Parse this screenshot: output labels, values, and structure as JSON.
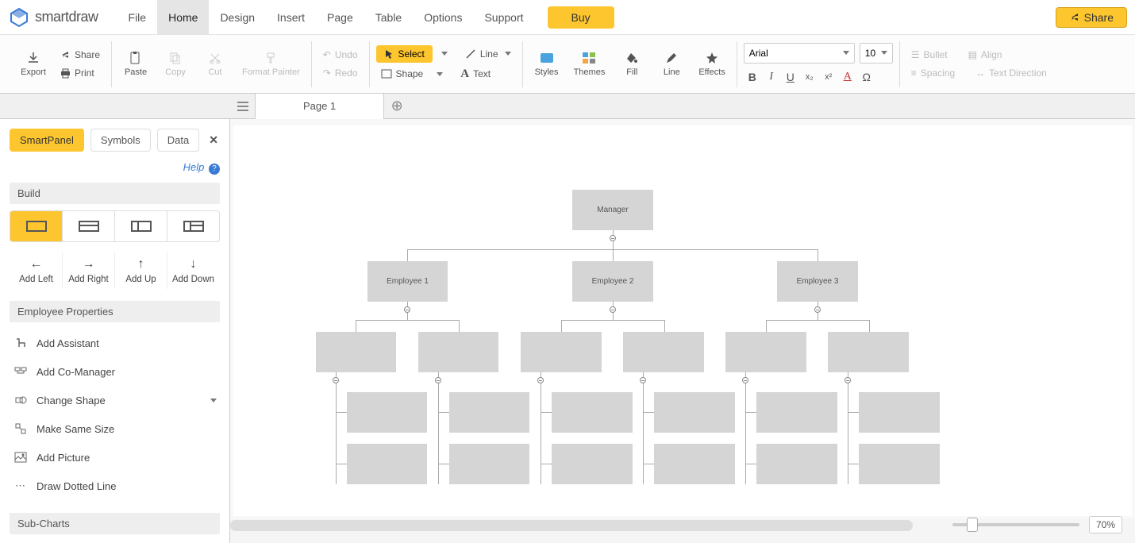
{
  "app": {
    "logo_text": "smartdraw"
  },
  "menu": {
    "items": [
      "File",
      "Home",
      "Design",
      "Insert",
      "Page",
      "Table",
      "Options",
      "Support"
    ],
    "active": "Home",
    "buy": "Buy",
    "share": "Share"
  },
  "ribbon": {
    "export": "Export",
    "share": "Share",
    "print": "Print",
    "paste": "Paste",
    "copy": "Copy",
    "cut": "Cut",
    "format_painter": "Format Painter",
    "undo": "Undo",
    "redo": "Redo",
    "select": "Select",
    "line": "Line",
    "shape": "Shape",
    "text": "Text",
    "styles": "Styles",
    "themes": "Themes",
    "fill": "Fill",
    "line2": "Line",
    "effects": "Effects",
    "font": "Arial",
    "size": "10",
    "bullet": "Bullet",
    "align": "Align",
    "spacing": "Spacing",
    "direction": "Text Direction"
  },
  "tabs": {
    "page": "Page 1"
  },
  "panel": {
    "tabs": {
      "smart": "SmartPanel",
      "symbols": "Symbols",
      "data": "Data"
    },
    "help": "Help",
    "build": "Build",
    "add_left": "Add Left",
    "add_right": "Add Right",
    "add_up": "Add Up",
    "add_down": "Add Down",
    "emp_props": "Employee Properties",
    "add_assistant": "Add Assistant",
    "add_comanager": "Add Co-Manager",
    "change_shape": "Change Shape",
    "same_size": "Make Same Size",
    "add_picture": "Add Picture",
    "dotted": "Draw Dotted Line",
    "subcharts": "Sub-Charts"
  },
  "chart": {
    "manager": "Manager",
    "emp1": "Employee 1",
    "emp2": "Employee 2",
    "emp3": "Employee 3"
  },
  "zoom": "70%"
}
